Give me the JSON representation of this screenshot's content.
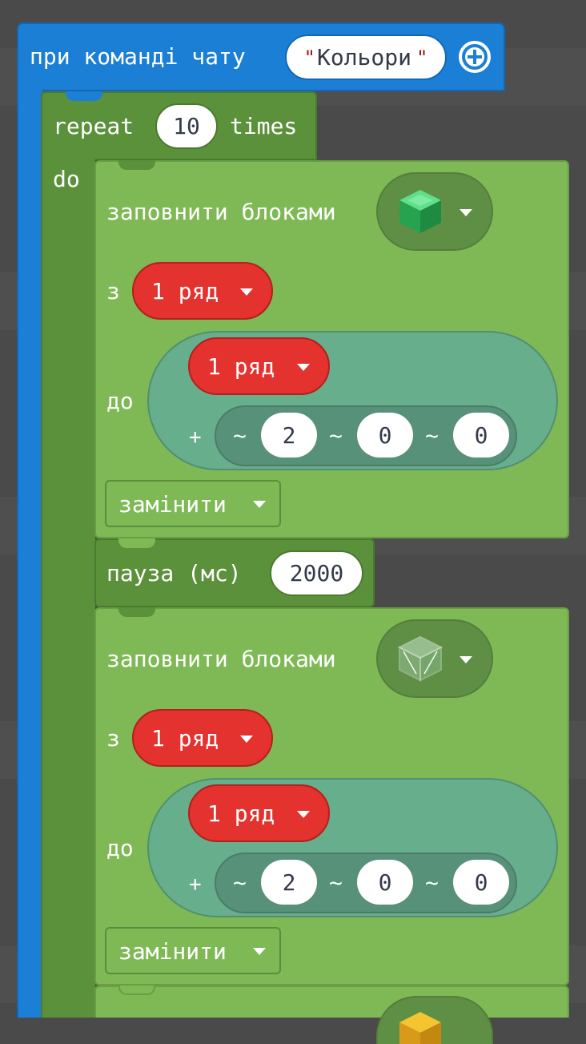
{
  "event": {
    "label": "при команді чату",
    "command": "Кольори",
    "quote_open": "\"",
    "quote_close": "\"",
    "add_icon": "plus-circle-icon"
  },
  "repeat": {
    "word": "repeat",
    "count": "10",
    "times": "times",
    "do": "do"
  },
  "fill1": {
    "label": "заповнити блоками",
    "block_icon": "emerald-block-icon",
    "from_label": "з",
    "from_value": "1 ряд",
    "to_label": "до",
    "to_value": "1 ряд",
    "plus": "+",
    "tilde": "~",
    "offset_x": "2",
    "offset_y": "0",
    "offset_z": "0",
    "mode": "замінити"
  },
  "pause": {
    "label": "пауза (мс)",
    "value": "2000"
  },
  "fill2": {
    "label": "заповнити блоками",
    "block_icon": "glass-block-icon",
    "from_label": "з",
    "from_value": "1 ряд",
    "to_label": "до",
    "to_value": "1 ряд",
    "plus": "+",
    "tilde": "~",
    "offset_x": "2",
    "offset_y": "0",
    "offset_z": "0",
    "mode": "замінити"
  },
  "fill3": {
    "block_icon": "gold-block-icon"
  },
  "colors": {
    "event_blue": "#1b7fd6",
    "loop_green": "#5c913b",
    "block_green": "#7eb955",
    "red": "#e4322f",
    "teal": "#67ae8d",
    "background": "#4a4a4a"
  }
}
